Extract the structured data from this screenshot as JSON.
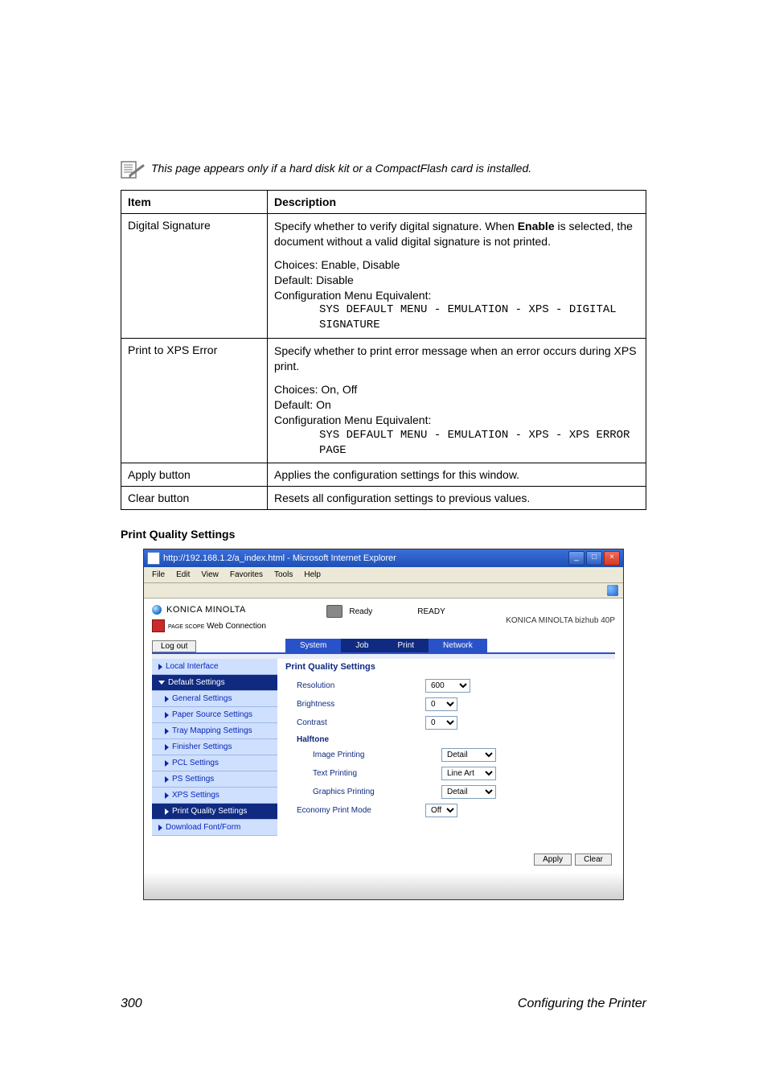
{
  "note": "This page appears only if a hard disk kit or a CompactFlash card is installed.",
  "table": {
    "head": {
      "item": "Item",
      "desc": "Description"
    },
    "rows": [
      {
        "item": "Digital Signature",
        "p1": "Specify whether to verify digital signature. When ",
        "p1b": "Enable",
        "p1c": " is selected, the document without a valid digital signature is not printed.",
        "p2a": "Choices: Enable, Disable",
        "p2b": "Default:  Disable",
        "p2c": "Configuration Menu Equivalent:",
        "m1": "SYS DEFAULT MENU - EMULATION - XPS - DIGITAL SIGNATURE"
      },
      {
        "item": "Print to XPS Error",
        "p1": "Specify whether to print error message when an error occurs during XPS print.",
        "p2a": "Choices: On, Off",
        "p2b": "Default:  On",
        "p2c": "Configuration Menu Equivalent:",
        "m1": "SYS DEFAULT MENU - EMULATION - XPS - XPS ERROR PAGE"
      },
      {
        "item": "Apply button",
        "p1": "Applies the configuration settings for this window."
      },
      {
        "item": "Clear button",
        "p1": "Resets all configuration settings to previous values."
      }
    ]
  },
  "sectionHead": "Print Quality Settings",
  "shot": {
    "title": "http://192.168.1.2/a_index.html - Microsoft Internet Explorer",
    "menus": [
      "File",
      "Edit",
      "View",
      "Favorites",
      "Tools",
      "Help"
    ],
    "brand": "KONICA MINOLTA",
    "pagescope": "Web Connection",
    "pagescopePrefix": "PAGE SCOPE",
    "readyLabel": "Ready",
    "readyCaps": "READY",
    "model": "KONICA MINOLTA bizhub 40P",
    "logout": "Log out",
    "tabs": [
      "System",
      "Job",
      "Print",
      "Network"
    ],
    "side": [
      "Local Interface",
      "Default Settings",
      "General Settings",
      "Paper Source Settings",
      "Tray Mapping Settings",
      "Finisher Settings",
      "PCL Settings",
      "PS Settings",
      "XPS Settings",
      "Print Quality Settings",
      "Download Font/Form"
    ],
    "panelHead": "Print Quality Settings",
    "fields": {
      "resolution": {
        "label": "Resolution",
        "value": "600"
      },
      "brightness": {
        "label": "Brightness",
        "value": "0"
      },
      "contrast": {
        "label": "Contrast",
        "value": "0"
      },
      "halftone": "Halftone",
      "image": {
        "label": "Image Printing",
        "value": "Detail"
      },
      "text": {
        "label": "Text Printing",
        "value": "Line Art"
      },
      "graphics": {
        "label": "Graphics Printing",
        "value": "Detail"
      },
      "economy": {
        "label": "Economy Print Mode",
        "value": "Off"
      }
    },
    "apply": "Apply",
    "clear": "Clear"
  },
  "footer": {
    "page": "300",
    "title": "Configuring the Printer"
  }
}
